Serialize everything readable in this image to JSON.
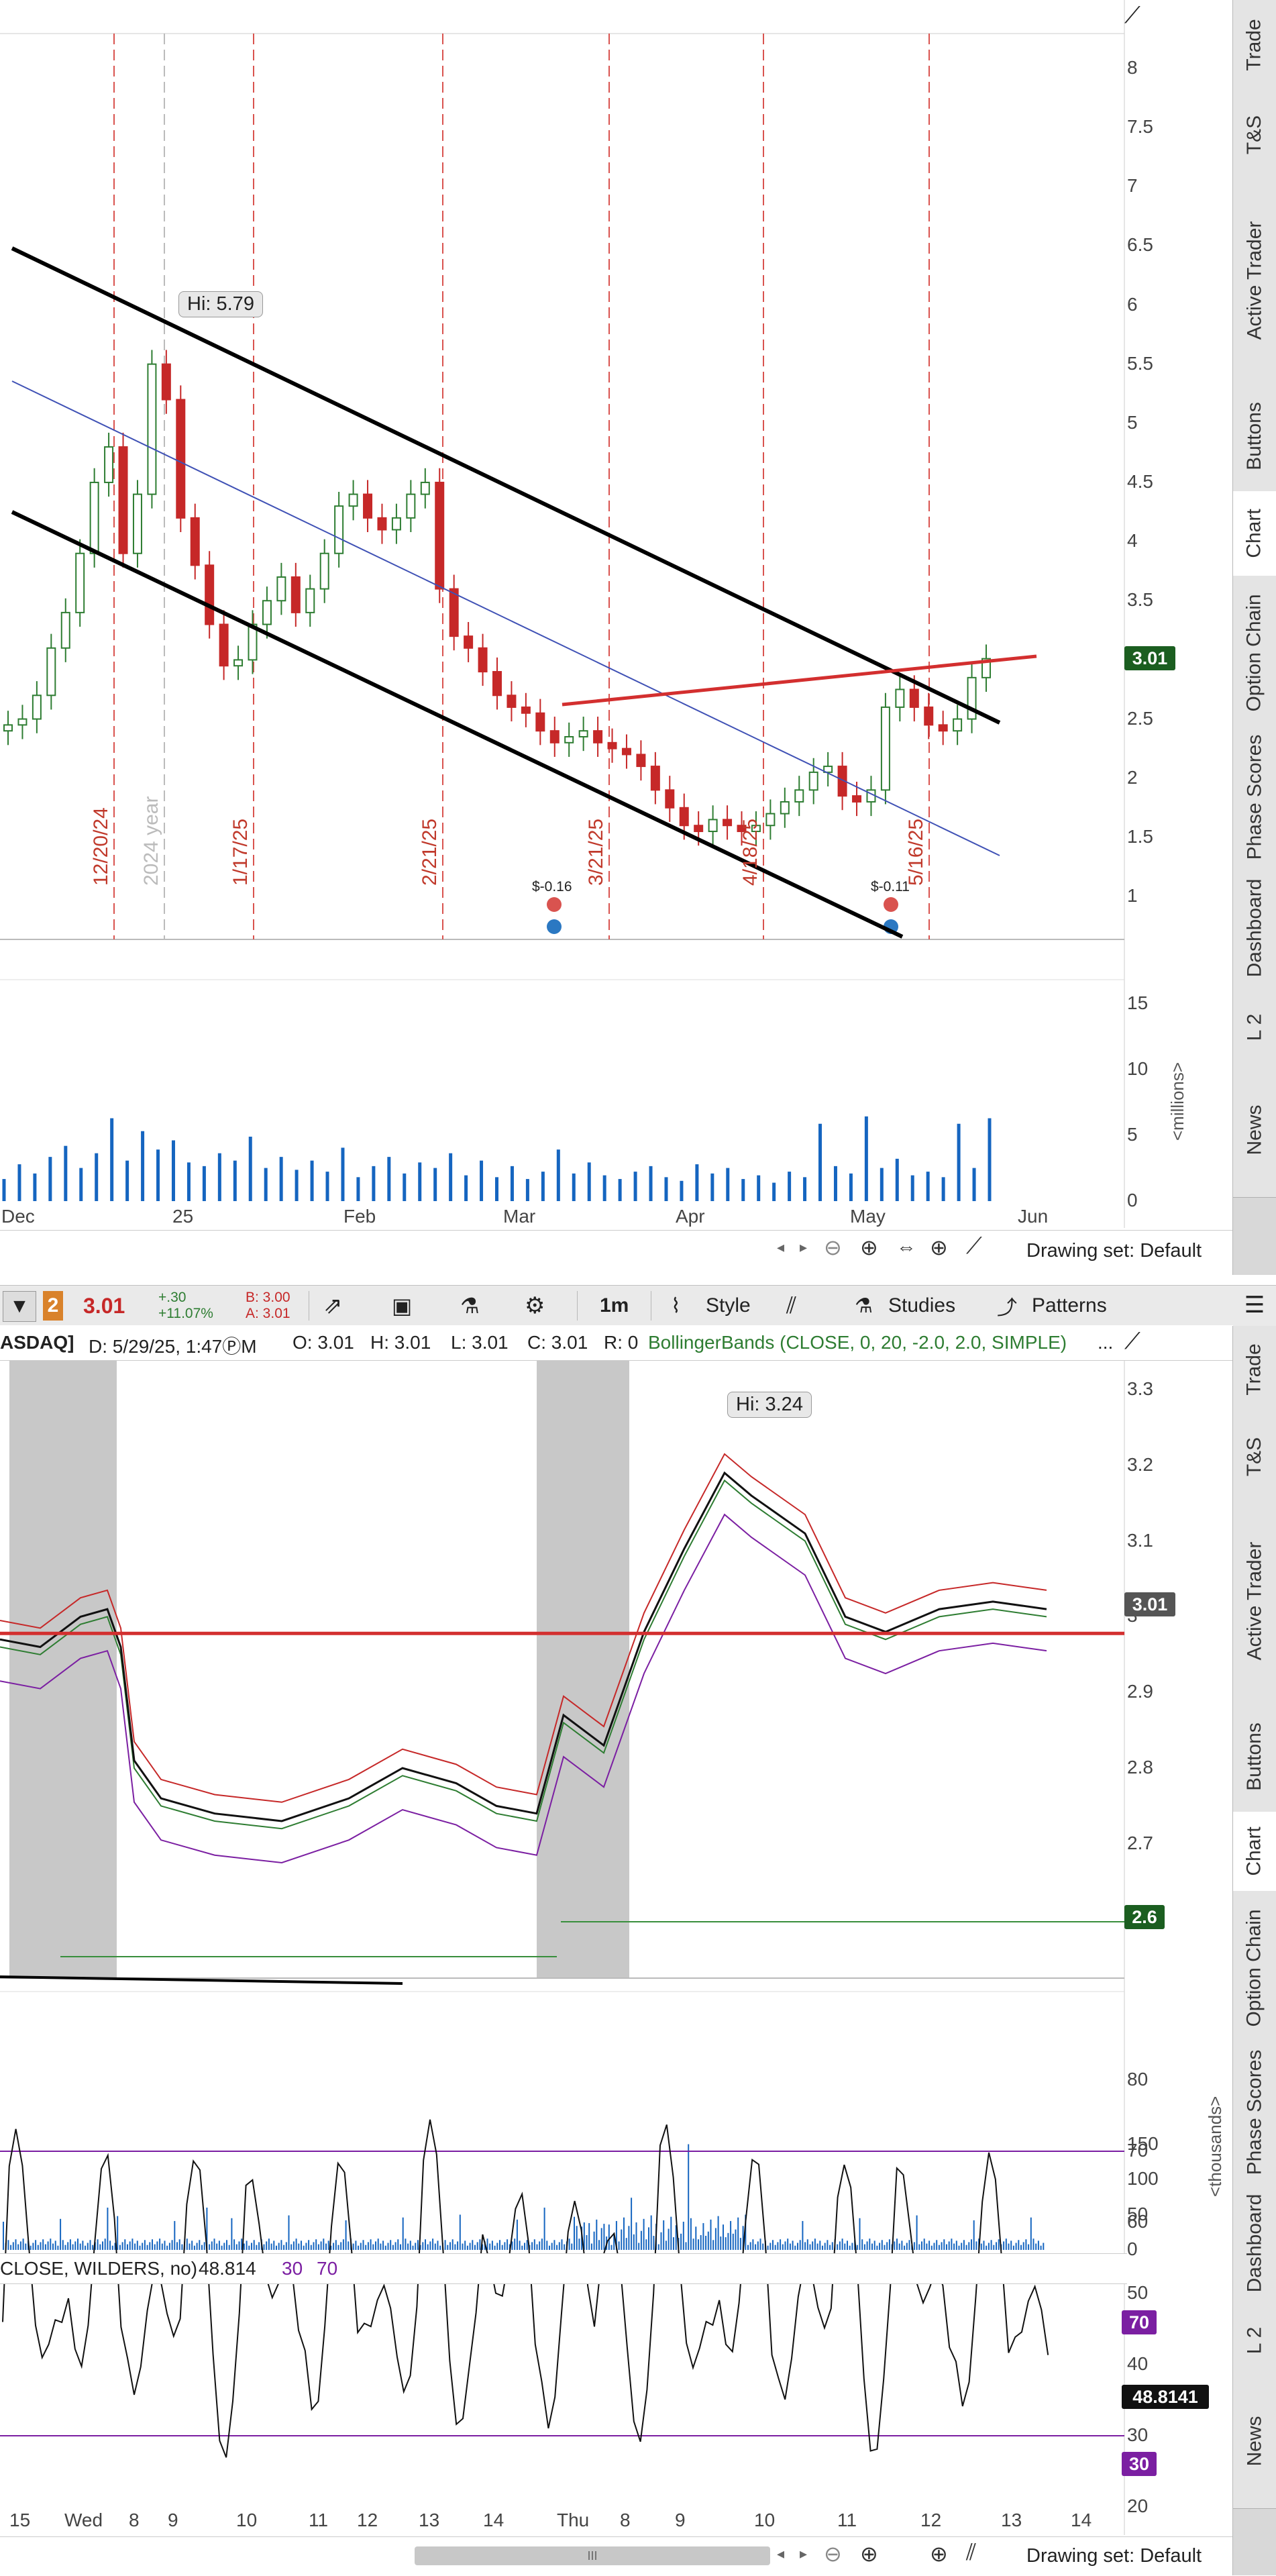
{
  "colors": {
    "candle_up": "#2e7d32",
    "candle_down": "#c62828",
    "channel": "#000000",
    "midline": "#3f51b5",
    "resistance": "#d32f2f",
    "volume": "#1565c0",
    "price_tag_green": "#1b5e20",
    "rsi": "#7b1fa2"
  },
  "top_chart": {
    "y_ticks": [
      "8",
      "7.5",
      "7",
      "6.5",
      "6",
      "5.5",
      "5",
      "4.5",
      "4",
      "3.5",
      "3",
      "2.5",
      "2",
      "1.5",
      "1"
    ],
    "last_price_tag": "3.01",
    "hi_label": "Hi: 5.79",
    "event_labels": [
      "12/20/24",
      "2024 year",
      "1/17/25",
      "2/21/25",
      "3/21/25",
      "4/18/25",
      "5/16/25"
    ],
    "earnings": [
      {
        "label": "$-0.16"
      },
      {
        "label": "$-0.11"
      }
    ],
    "volume_ticks": [
      "15",
      "10",
      "5",
      "0"
    ],
    "volume_unit": "<millions>",
    "x_ticks": [
      "Dec",
      "25",
      "Feb",
      "Mar",
      "Apr",
      "May",
      "Jun"
    ]
  },
  "top_footer": {
    "drawing_set": "Drawing set: Default"
  },
  "toolbar": {
    "alert_badge": "2",
    "last": "3.01",
    "change_line1": "+.30",
    "change_line2": "+11.07%",
    "bid": "B: 3.00",
    "ask": "A: 3.01",
    "interval": "1m",
    "style_label": "Style",
    "studies_label": "Studies",
    "patterns_label": "Patterns"
  },
  "infobar": {
    "symbol": "ASDAQ]",
    "date": "D: 5/29/25, 1:47ⓅM",
    "open": "O: 3.01",
    "high": "H: 3.01",
    "low": "L: 3.01",
    "close": "C: 3.01",
    "range": "R: 0",
    "study": "BollingerBands (CLOSE, 0, 20, -2.0, 2.0, SIMPLE)",
    "more": "..."
  },
  "bottom_chart": {
    "y_ticks": [
      "3.3",
      "3.2",
      "3.1",
      "3",
      "2.9",
      "2.8",
      "2.7"
    ],
    "hi_label": "Hi: 3.24",
    "last_price_tag": "3.01",
    "level_tag": "2.6",
    "volume_ticks": [
      "150",
      "100",
      "50",
      "0"
    ],
    "volume_unit": "<thousands>",
    "rsi_header": "CLOSE, WILDERS, no)",
    "rsi_value": "48.814",
    "rsi_ob": "30",
    "rsi_os": "70",
    "rsi_ticks": [
      "80",
      "70",
      "60",
      "50",
      "40",
      "30",
      "20"
    ],
    "rsi_tag": "48.8141",
    "rsi_tag_70": "70",
    "rsi_tag_30": "30",
    "x_ticks": [
      "15",
      "Wed",
      "8",
      "9",
      "10",
      "11",
      "12",
      "13",
      "14",
      "Thu",
      "8",
      "9",
      "10",
      "11",
      "12",
      "13",
      "14"
    ]
  },
  "bottom_footer": {
    "drawing_set": "Drawing set: Default",
    "scroll_grip": "III"
  },
  "sidebar": {
    "top_tabs": [
      "Trade",
      "T&S",
      "Active Trader",
      "Buttons",
      "Chart",
      "Option Chain",
      "Phase Scores",
      "Dashboard",
      "L 2",
      "News"
    ],
    "bottom_tabs": [
      "Trade",
      "T&S",
      "Active Trader",
      "Buttons",
      "Chart",
      "Option Chain",
      "Phase Scores",
      "Dashboard",
      "L 2",
      "News"
    ],
    "active": "Chart"
  }
}
